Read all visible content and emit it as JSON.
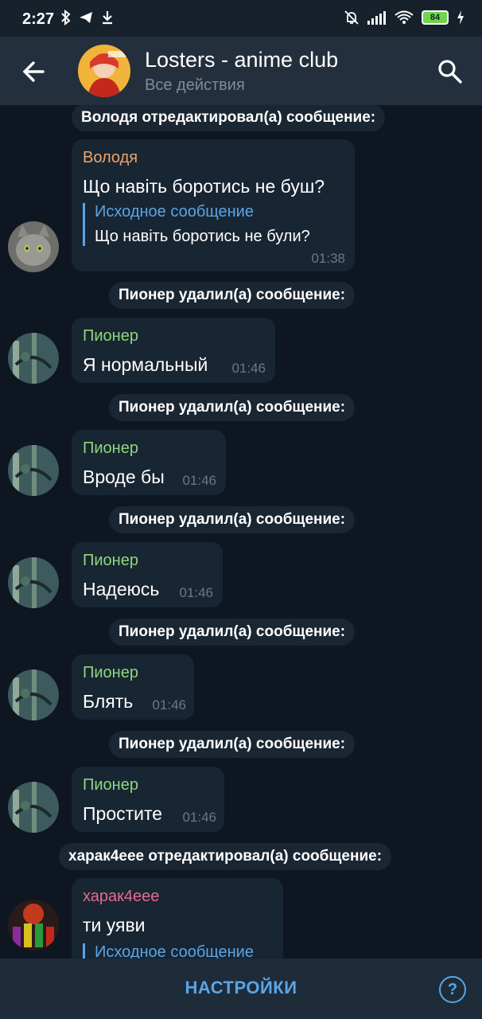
{
  "status_bar": {
    "time": "2:27",
    "battery": "84"
  },
  "header": {
    "title": "Losters - anime club",
    "subtitle": "Все действия"
  },
  "events": [
    {
      "system": "Володя отредактировал(а) сообщение:"
    },
    {
      "sender": "Володя",
      "text": "Що навіть боротись не буш?",
      "quote_title": "Исходное сообщение",
      "quote_text": "Що навіть боротись не були?",
      "time": "01:38"
    },
    {
      "system": "Пионер удалил(а) сообщение:"
    },
    {
      "sender": "Пионер",
      "text": "Я нормальный",
      "time": "01:46"
    },
    {
      "system": "Пионер удалил(а) сообщение:"
    },
    {
      "sender": "Пионер",
      "text": "Вроде бы",
      "time": "01:46"
    },
    {
      "system": "Пионер удалил(а) сообщение:"
    },
    {
      "sender": "Пионер",
      "text": "Надеюсь",
      "time": "01:46"
    },
    {
      "system": "Пионер удалил(а) сообщение:"
    },
    {
      "sender": "Пионер",
      "text": "Блять",
      "time": "01:46"
    },
    {
      "system": "Пионер удалил(а) сообщение:"
    },
    {
      "sender": "Пионер",
      "text": "Простите",
      "time": "01:46"
    },
    {
      "system": "харак4еее отредактировал(а) сообщение:"
    },
    {
      "sender": "харак4еее",
      "text": "ти уяви",
      "quote_title": "Исходное сообщение"
    }
  ],
  "bottom_bar": {
    "settings_label": "НАСТРОЙКИ",
    "help_label": "?"
  },
  "colors": {
    "volodya": "#f0a36b",
    "pioner": "#8fd67a",
    "kharak": "#e46b8d",
    "link": "#5aa5e6"
  }
}
